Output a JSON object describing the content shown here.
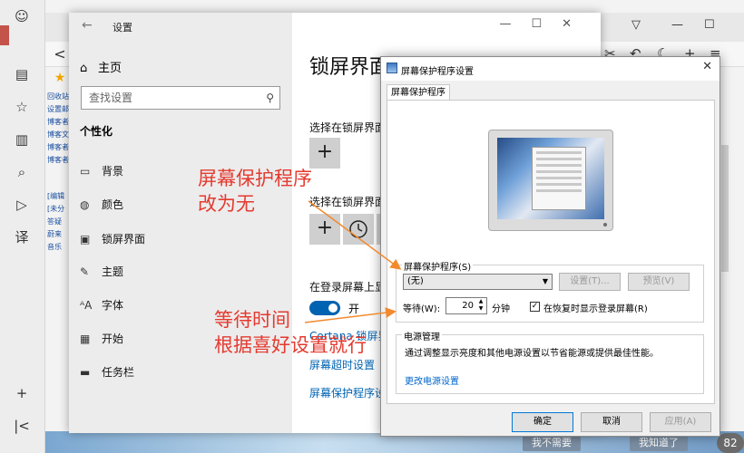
{
  "settings": {
    "title": "设置",
    "home": "主页",
    "search_placeholder": "查找设置",
    "section": "个性化",
    "nav": [
      "背景",
      "颜色",
      "锁屏界面",
      "主题",
      "字体",
      "开始",
      "任务栏"
    ],
    "main_title": "锁屏界面",
    "choose_detail": "选择在锁屏界面",
    "choose_quick": "选择在锁屏界面",
    "show_bg_on_login": "在登录屏幕上显",
    "toggle_label": "开",
    "cortana_link": "Cortana 锁屏界",
    "timeout_link": "屏幕超时设置",
    "saver_link": "屏幕保护程序设"
  },
  "dialog": {
    "title": "屏幕保护程序设置",
    "tab": "屏幕保护程序",
    "saver_group": "屏幕保护程序(S)",
    "selected_saver": "(无)",
    "settings_btn": "设置(T)...",
    "preview_btn": "预览(V)",
    "wait_label": "等待(W):",
    "wait_value": "20",
    "wait_unit": "分钟",
    "resume_checkbox": "在恢复时显示登录屏幕(R)",
    "resume_checked": true,
    "power_group": "电源管理",
    "power_text": "通过调整显示亮度和其他电源设置以节省能源或提供最佳性能。",
    "power_link": "更改电源设置",
    "ok": "确定",
    "cancel": "取消",
    "apply": "应用(A)"
  },
  "annotations": {
    "line1": "屏幕保护程序",
    "line2": "改为无",
    "line3": "等待时间",
    "line4": "根据喜好设置就行",
    "color": "#e53a2f"
  },
  "browser": {
    "fav_items": [
      "回收站",
      "设置邮",
      "博客者",
      "博客文",
      "博客者",
      "博客者",
      "[编辑",
      "[未分",
      "答疑",
      "蔚来",
      "音乐"
    ],
    "bottom_btn1": "我不需要",
    "bottom_btn2": "我知道了",
    "badge": "82"
  }
}
